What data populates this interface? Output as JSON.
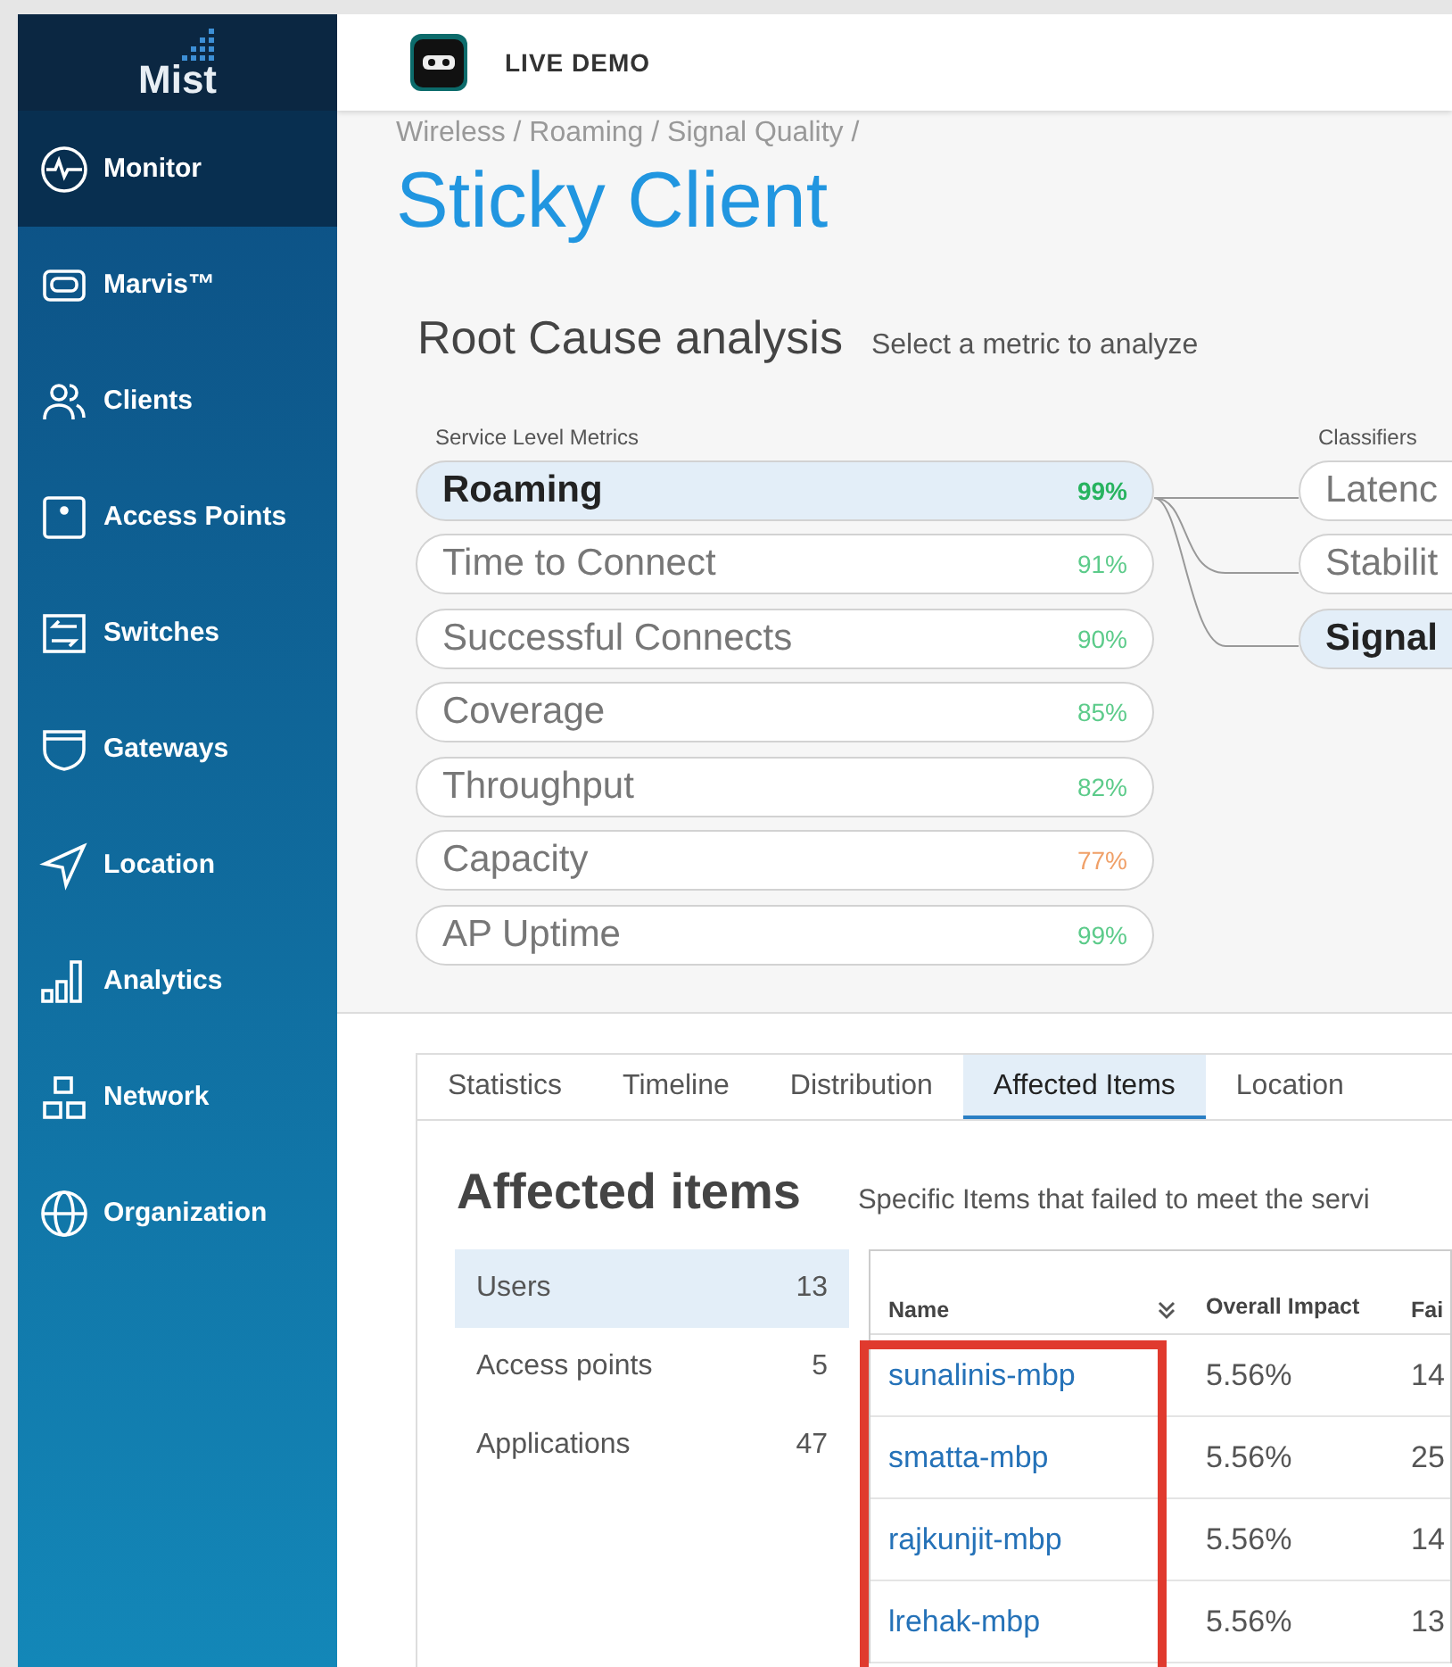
{
  "sidebar": {
    "logo": "Mist",
    "items": [
      {
        "label": "Monitor",
        "selected": true
      },
      {
        "label": "Marvis™",
        "selected": false
      },
      {
        "label": "Clients",
        "selected": false
      },
      {
        "label": "Access Points",
        "selected": false
      },
      {
        "label": "Switches",
        "selected": false
      },
      {
        "label": "Gateways",
        "selected": false
      },
      {
        "label": "Location",
        "selected": false
      },
      {
        "label": "Analytics",
        "selected": false
      },
      {
        "label": "Network",
        "selected": false
      },
      {
        "label": "Organization",
        "selected": false
      }
    ]
  },
  "header": {
    "title": "LIVE DEMO"
  },
  "breadcrumb": "Wireless / Roaming / Signal Quality /",
  "page_title": "Sticky Client",
  "root_cause": {
    "title": "Root Cause analysis",
    "hint": "Select a metric to analyze",
    "metrics_label": "Service Level Metrics",
    "classifiers_label": "Classifiers",
    "metrics": [
      {
        "label": "Roaming",
        "value": "99%",
        "color": "#27b35f",
        "selected": true
      },
      {
        "label": "Time to Connect",
        "value": "91%",
        "color": "#5ccb8a",
        "selected": false
      },
      {
        "label": "Successful Connects",
        "value": "90%",
        "color": "#5ccb8a",
        "selected": false
      },
      {
        "label": "Coverage",
        "value": "85%",
        "color": "#5ccb8a",
        "selected": false
      },
      {
        "label": "Throughput",
        "value": "82%",
        "color": "#5ccb8a",
        "selected": false
      },
      {
        "label": "Capacity",
        "value": "77%",
        "color": "#f0a068",
        "selected": false
      },
      {
        "label": "AP Uptime",
        "value": "99%",
        "color": "#5ccb8a",
        "selected": false
      }
    ],
    "classifiers": [
      {
        "label": "Latenc",
        "selected": false
      },
      {
        "label": "Stabilit",
        "selected": false
      },
      {
        "label": "Signal",
        "selected": true
      }
    ]
  },
  "tabs": [
    {
      "label": "Statistics",
      "selected": false
    },
    {
      "label": "Timeline",
      "selected": false
    },
    {
      "label": "Distribution",
      "selected": false
    },
    {
      "label": "Affected Items",
      "selected": true
    },
    {
      "label": "Location",
      "selected": false
    }
  ],
  "affected": {
    "title": "Affected items",
    "description": "Specific Items that failed to meet the servi",
    "categories": [
      {
        "label": "Users",
        "count": "13",
        "selected": true
      },
      {
        "label": "Access points",
        "count": "5",
        "selected": false
      },
      {
        "label": "Applications",
        "count": "47",
        "selected": false
      }
    ],
    "table": {
      "columns": [
        "Name",
        "Overall Impact",
        "Fai"
      ],
      "rows": [
        {
          "name": "sunalinis-mbp",
          "impact": "5.56%",
          "column_3": "14"
        },
        {
          "name": "smatta-mbp",
          "impact": "5.56%",
          "column_3": "25"
        },
        {
          "name": "rajkunjit-mbp",
          "impact": "5.56%",
          "column_3": "14"
        },
        {
          "name": "lrehak-mbp",
          "impact": "5.56%",
          "column_3": "13"
        }
      ]
    }
  }
}
